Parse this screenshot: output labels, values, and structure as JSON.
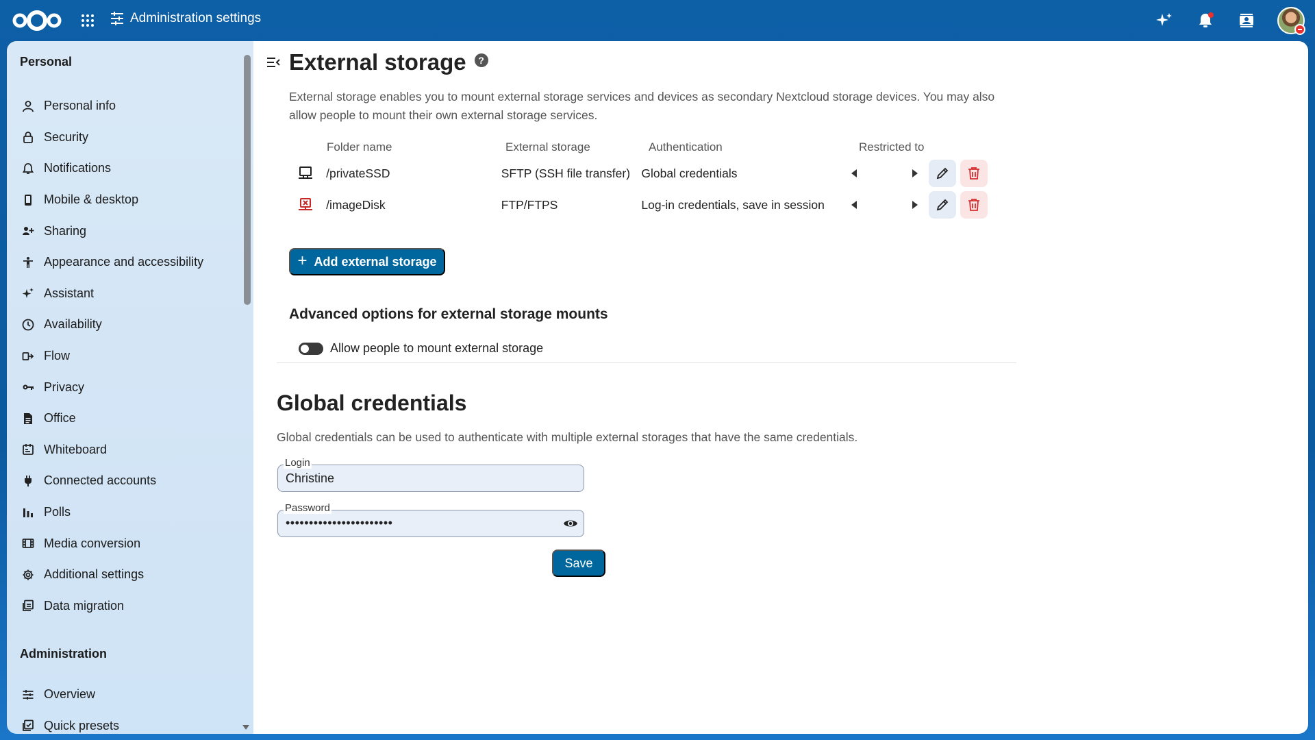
{
  "header": {
    "title": "Administration settings",
    "icons": [
      "nextcloud-logo",
      "apps-grid-icon",
      "admin-settings-icon",
      "assistant-sparkle-icon",
      "notifications-bell-icon",
      "contacts-icon",
      "user-avatar"
    ]
  },
  "sidebar": {
    "personal_heading": "Personal",
    "admin_heading": "Administration",
    "personal_items": [
      {
        "label": "Personal info",
        "icon": "person-icon"
      },
      {
        "label": "Security",
        "icon": "lock-icon"
      },
      {
        "label": "Notifications",
        "icon": "bell-icon"
      },
      {
        "label": "Mobile & desktop",
        "icon": "phone-icon"
      },
      {
        "label": "Sharing",
        "icon": "share-icon"
      },
      {
        "label": "Appearance and accessibility",
        "icon": "accessibility-icon"
      },
      {
        "label": "Assistant",
        "icon": "sparkle-icon"
      },
      {
        "label": "Availability",
        "icon": "clock-icon"
      },
      {
        "label": "Flow",
        "icon": "flow-icon"
      },
      {
        "label": "Privacy",
        "icon": "key-icon"
      },
      {
        "label": "Office",
        "icon": "document-icon"
      },
      {
        "label": "Whiteboard",
        "icon": "whiteboard-icon"
      },
      {
        "label": "Connected accounts",
        "icon": "plug-icon"
      },
      {
        "label": "Polls",
        "icon": "polls-icon"
      },
      {
        "label": "Media conversion",
        "icon": "film-icon"
      },
      {
        "label": "Additional settings",
        "icon": "gear-icon"
      },
      {
        "label": "Data migration",
        "icon": "migration-icon"
      }
    ],
    "admin_items": [
      {
        "label": "Overview",
        "icon": "tune-icon"
      },
      {
        "label": "Quick presets",
        "icon": "presets-icon"
      }
    ]
  },
  "main": {
    "title": "External storage",
    "intro": "External storage enables you to mount external storage services and devices as secondary Nextcloud storage devices. You may also allow people to mount their own external storage services.",
    "table": {
      "headers": {
        "folder": "Folder name",
        "external": "External storage",
        "auth": "Authentication",
        "restricted": "Restricted to"
      },
      "rows": [
        {
          "folder": "/privateSSD",
          "external": "SFTP (SSH file transfer)",
          "auth": "Global credentials",
          "status": "ok",
          "status_icon": "monitor-icon"
        },
        {
          "folder": "/imageDisk",
          "external": "FTP/FTPS",
          "auth": "Log-in credentials, save in session",
          "status": "error",
          "status_icon": "monitor-error-icon"
        }
      ]
    },
    "add_button": "Add external storage",
    "advanced_title": "Advanced options for external storage mounts",
    "allow_toggle_label": "Allow people to mount external storage",
    "allow_toggle_on": false,
    "global_credentials": {
      "title": "Global credentials",
      "description": "Global credentials can be used to authenticate with multiple external storages that have the same credentials.",
      "login_label": "Login",
      "login_value": "Christine",
      "password_label": "Password",
      "password_value": "•••••••••••••••••••••••",
      "save_label": "Save"
    }
  },
  "colors": {
    "brand": "#0b5aa0",
    "primary_button": "#00679e",
    "delete_red": "#d32f2f",
    "error_icon": "#c62828"
  }
}
